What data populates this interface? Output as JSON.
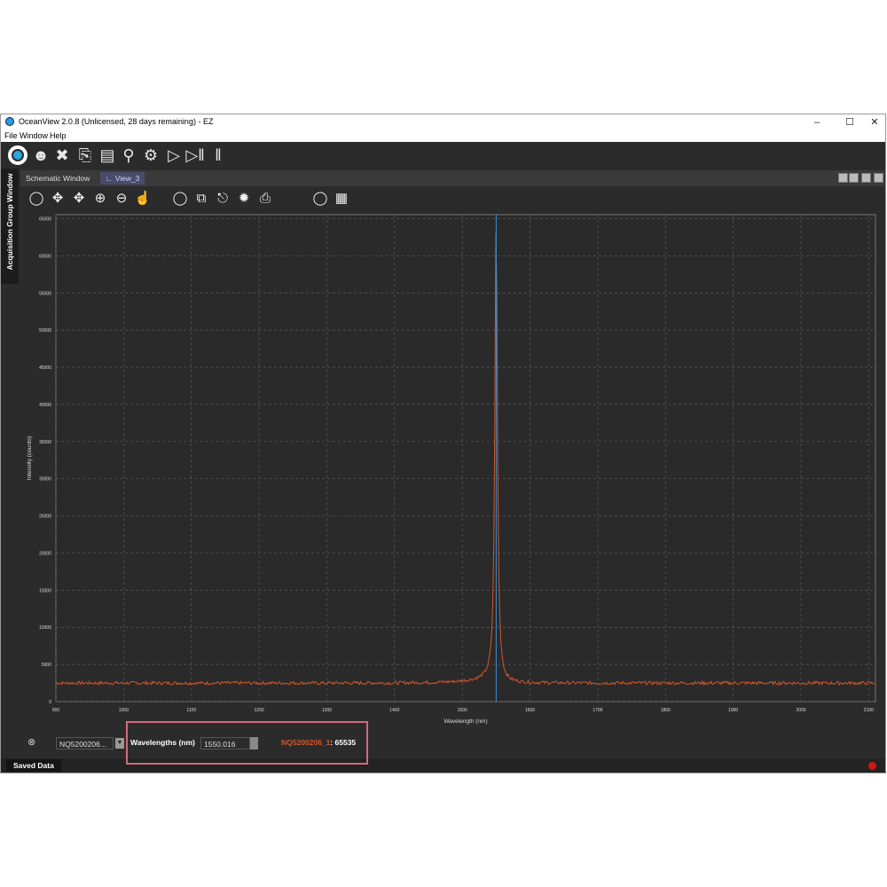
{
  "window": {
    "title": "OceanView 2.0.8 (Unlicensed, 28 days remaining) - EZ",
    "minimize": "–",
    "maximize": "☐",
    "close": "✕"
  },
  "menu": [
    "File",
    "Window",
    "Help"
  ],
  "sidebar_tab": "Acquisition Group Window",
  "tabs": {
    "schematic": "Schematic Window",
    "view": "View_3"
  },
  "chart_data": {
    "type": "line",
    "xlabel": "Wavelength (nm)",
    "ylabel": "Intensity (counts)",
    "xlim": [
      900,
      2110
    ],
    "ylim": [
      0,
      65535
    ],
    "x_ticks": [
      "900",
      "1000",
      "1100",
      "1200",
      "1300",
      "1400",
      "1500",
      "1600",
      "1700",
      "1800",
      "1900",
      "2000",
      "2100"
    ],
    "y_ticks": [
      "0",
      "5000",
      "10000",
      "15000",
      "20000",
      "25000",
      "30000",
      "35000",
      "40000",
      "45000",
      "50000",
      "55000",
      "60000",
      "65000"
    ],
    "grid": true,
    "cursor_x": 1550.016,
    "series": [
      {
        "color": "#d4562a",
        "baseline": 2500,
        "peak_x": 1550.016,
        "peak_y": 65535
      }
    ],
    "cursor_color": "#3b8fd6"
  },
  "bottom": {
    "spectrum": "NQ5200206...",
    "wavelength_label": "Wavelengths (nm)",
    "wavelength_value": "1550.016",
    "readout_name": "NQ5200206_1",
    "readout_sep": ":",
    "readout_value": "65535"
  },
  "status": {
    "saved_data": "Saved Data"
  },
  "colors": {
    "accent": "#d4562a",
    "cursor": "#3b8fd6",
    "highlight": "#d46a7a"
  }
}
